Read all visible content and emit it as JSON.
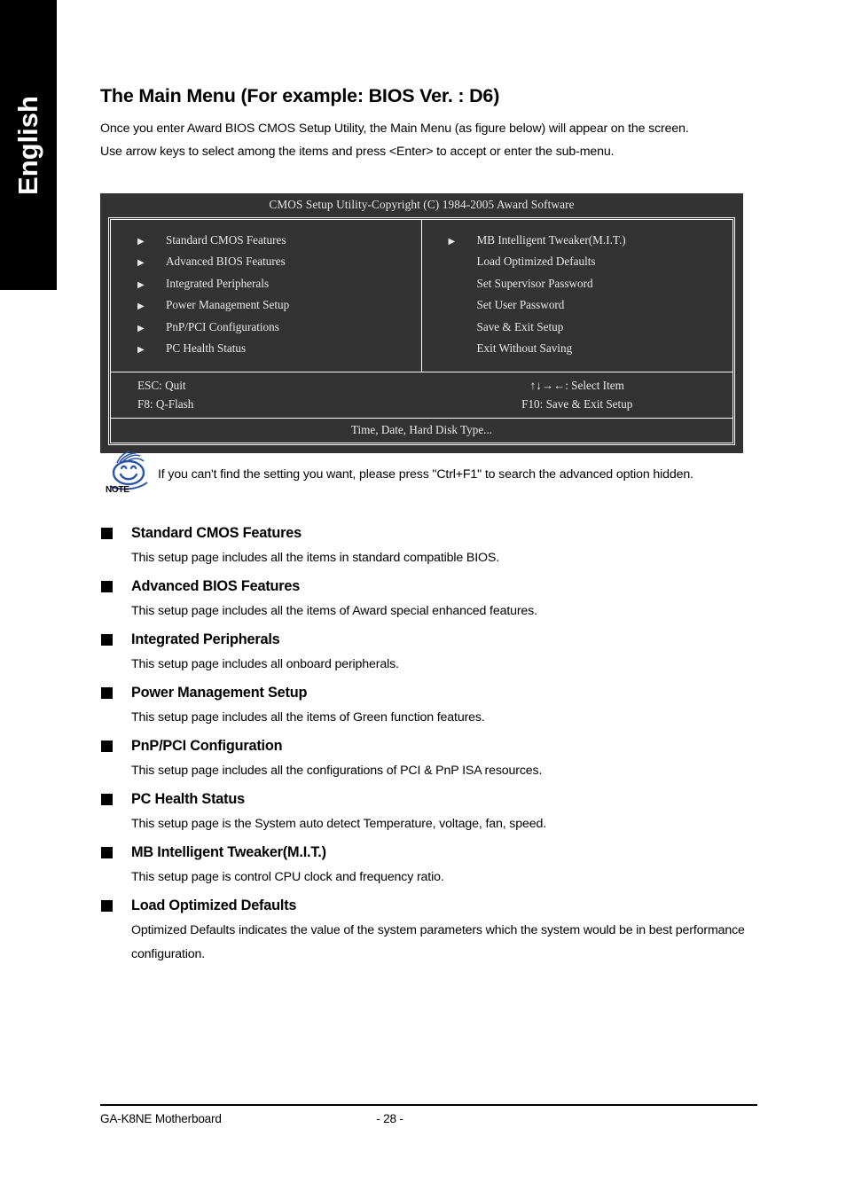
{
  "sidebar": {
    "language_tab": "English"
  },
  "header": {
    "title": "The Main Menu (For example: BIOS Ver. : D6)",
    "intro_line1": "Once you enter Award BIOS CMOS Setup Utility, the Main Menu (as figure below) will appear on the screen.",
    "intro_line2": "Use arrow keys to select among the items and press <Enter> to accept or enter the sub-menu."
  },
  "bios_screen": {
    "title": "CMOS Setup Utility-Copyright (C) 1984-2005 Award Software",
    "arrow_glyph": "▶",
    "left_items": [
      {
        "label": "Standard CMOS Features",
        "has_arrow": true
      },
      {
        "label": "Advanced BIOS Features",
        "has_arrow": true
      },
      {
        "label": "Integrated Peripherals",
        "has_arrow": true
      },
      {
        "label": "Power Management Setup",
        "has_arrow": true
      },
      {
        "label": "PnP/PCI Configurations",
        "has_arrow": true
      },
      {
        "label": "PC Health Status",
        "has_arrow": true
      }
    ],
    "right_items": [
      {
        "label": "MB Intelligent Tweaker(M.I.T.)",
        "has_arrow": true
      },
      {
        "label": "Load Optimized Defaults",
        "has_arrow": false
      },
      {
        "label": "Set Supervisor Password",
        "has_arrow": false
      },
      {
        "label": "Set User Password",
        "has_arrow": false
      },
      {
        "label": "Save & Exit Setup",
        "has_arrow": false
      },
      {
        "label": "Exit Without Saving",
        "has_arrow": false
      }
    ],
    "keys": {
      "esc": "ESC: Quit",
      "f8": "F8: Q-Flash",
      "select": "↑↓→←: Select Item",
      "f10": "F10: Save & Exit Setup"
    },
    "hint": "Time, Date, Hard Disk Type...",
    "bg_color": "#333333",
    "text_color": "#e8e8e8",
    "border_color": "#ffffff"
  },
  "note": {
    "icon_label": "NOTE",
    "icon_color": "#2b55a8",
    "text": "If you can't find the setting you want, please press \"Ctrl+F1\" to search the advanced option hidden."
  },
  "sections": [
    {
      "title": "Standard CMOS Features",
      "body": "This setup page includes all the items in standard compatible BIOS."
    },
    {
      "title": "Advanced BIOS Features",
      "body": "This setup page includes all the items of Award special enhanced features."
    },
    {
      "title": "Integrated Peripherals",
      "body": "This setup page includes all onboard peripherals."
    },
    {
      "title": "Power Management Setup",
      "body": "This setup page includes all the items of Green function features."
    },
    {
      "title": "PnP/PCI Configuration",
      "body": "This setup page includes all the configurations of PCI & PnP ISA resources."
    },
    {
      "title": "PC Health Status",
      "body": "This setup page is the System auto detect Temperature, voltage, fan, speed."
    },
    {
      "title": "MB Intelligent Tweaker(M.I.T.)",
      "body": "This setup page is control CPU clock and frequency ratio."
    },
    {
      "title": "Load Optimized Defaults",
      "body": "Optimized Defaults indicates the value of the system parameters which the system would be in best performance configuration."
    }
  ],
  "footer": {
    "product": "GA-K8NE Motherboard",
    "page_number": "- 28 -"
  }
}
